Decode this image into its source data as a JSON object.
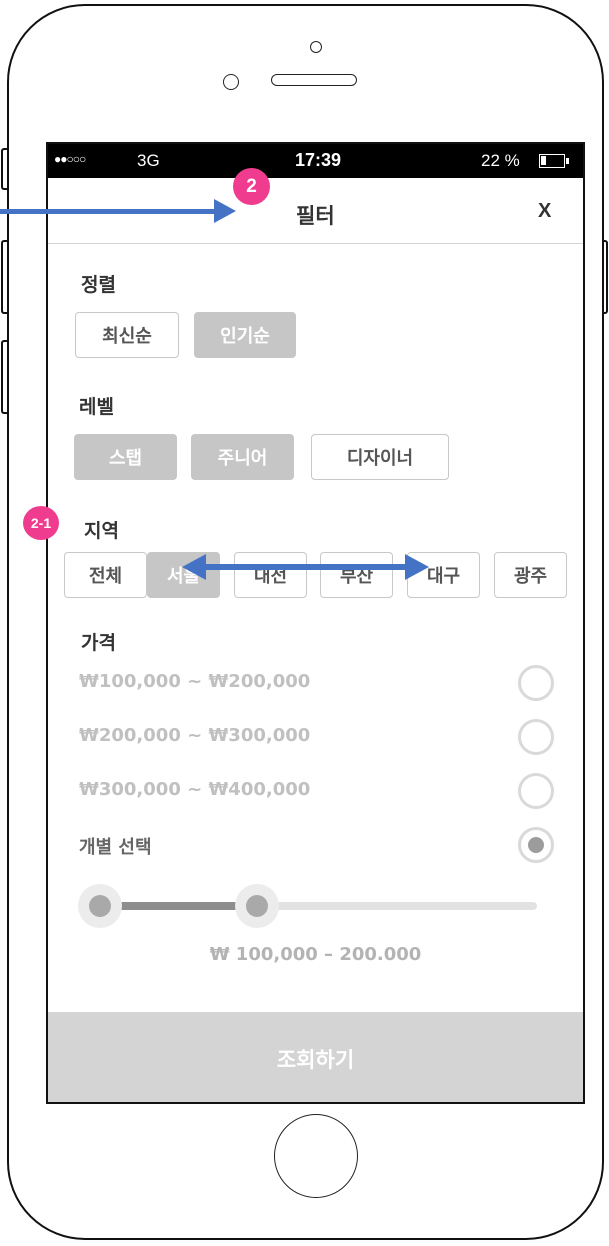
{
  "status_bar": {
    "signal": "●●○○○",
    "carrier": "3G",
    "time": "17:39",
    "battery": "22 %"
  },
  "header": {
    "title": "필터",
    "close": "X"
  },
  "sort": {
    "label": "정렬",
    "options": [
      "최신순",
      "인기순"
    ],
    "selected": "인기순"
  },
  "level": {
    "label": "레벨",
    "options": [
      "스탭",
      "주니어",
      "디자이너"
    ],
    "selected": [
      "스탭",
      "주니어"
    ]
  },
  "region": {
    "label": "지역",
    "options": [
      "전체",
      "서울",
      "대전",
      "부산",
      "대구",
      "광주"
    ],
    "selected": "서울"
  },
  "price": {
    "label": "가격",
    "options": [
      "₩100,000 ~ ₩200,000",
      "₩200,000 ~ ₩300,000",
      "₩300,000 ~ ₩400,000"
    ],
    "custom_label": "개별 선택",
    "selected": "개별 선택",
    "range_text": "₩ 100,000 – 200.000",
    "range_min": 100000,
    "range_max": 200000
  },
  "submit_label": "조회하기",
  "annotations": {
    "badge_header": "2",
    "badge_region": "2-1"
  },
  "colors": {
    "badge": "#f03c8e",
    "arrow": "#4472c4",
    "selected_chip": "#c6c6c6"
  }
}
